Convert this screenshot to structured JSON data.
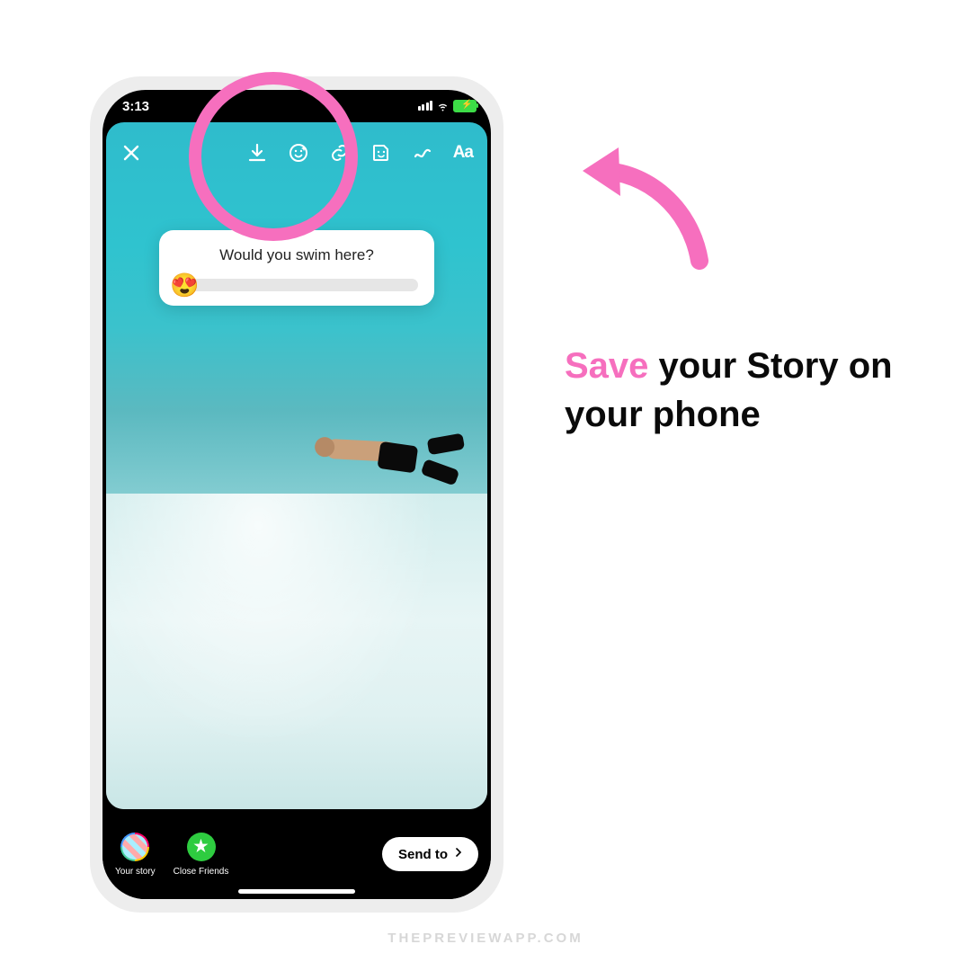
{
  "status": {
    "time": "3:13"
  },
  "editor": {
    "text_tool_label": "Aa"
  },
  "poll": {
    "question": "Would you swim here?",
    "emoji": "😍"
  },
  "bottom": {
    "your_story_label": "Your story",
    "close_friends_label": "Close Friends",
    "close_friends_star": "★",
    "send_to_label": "Send to"
  },
  "callout": {
    "word_save": "Save",
    "rest": " your Story on your phone"
  },
  "watermark": "THEPREVIEWAPP.COM",
  "colors": {
    "accent_pink": "#f66fbe",
    "battery_green": "#3ddc47"
  }
}
